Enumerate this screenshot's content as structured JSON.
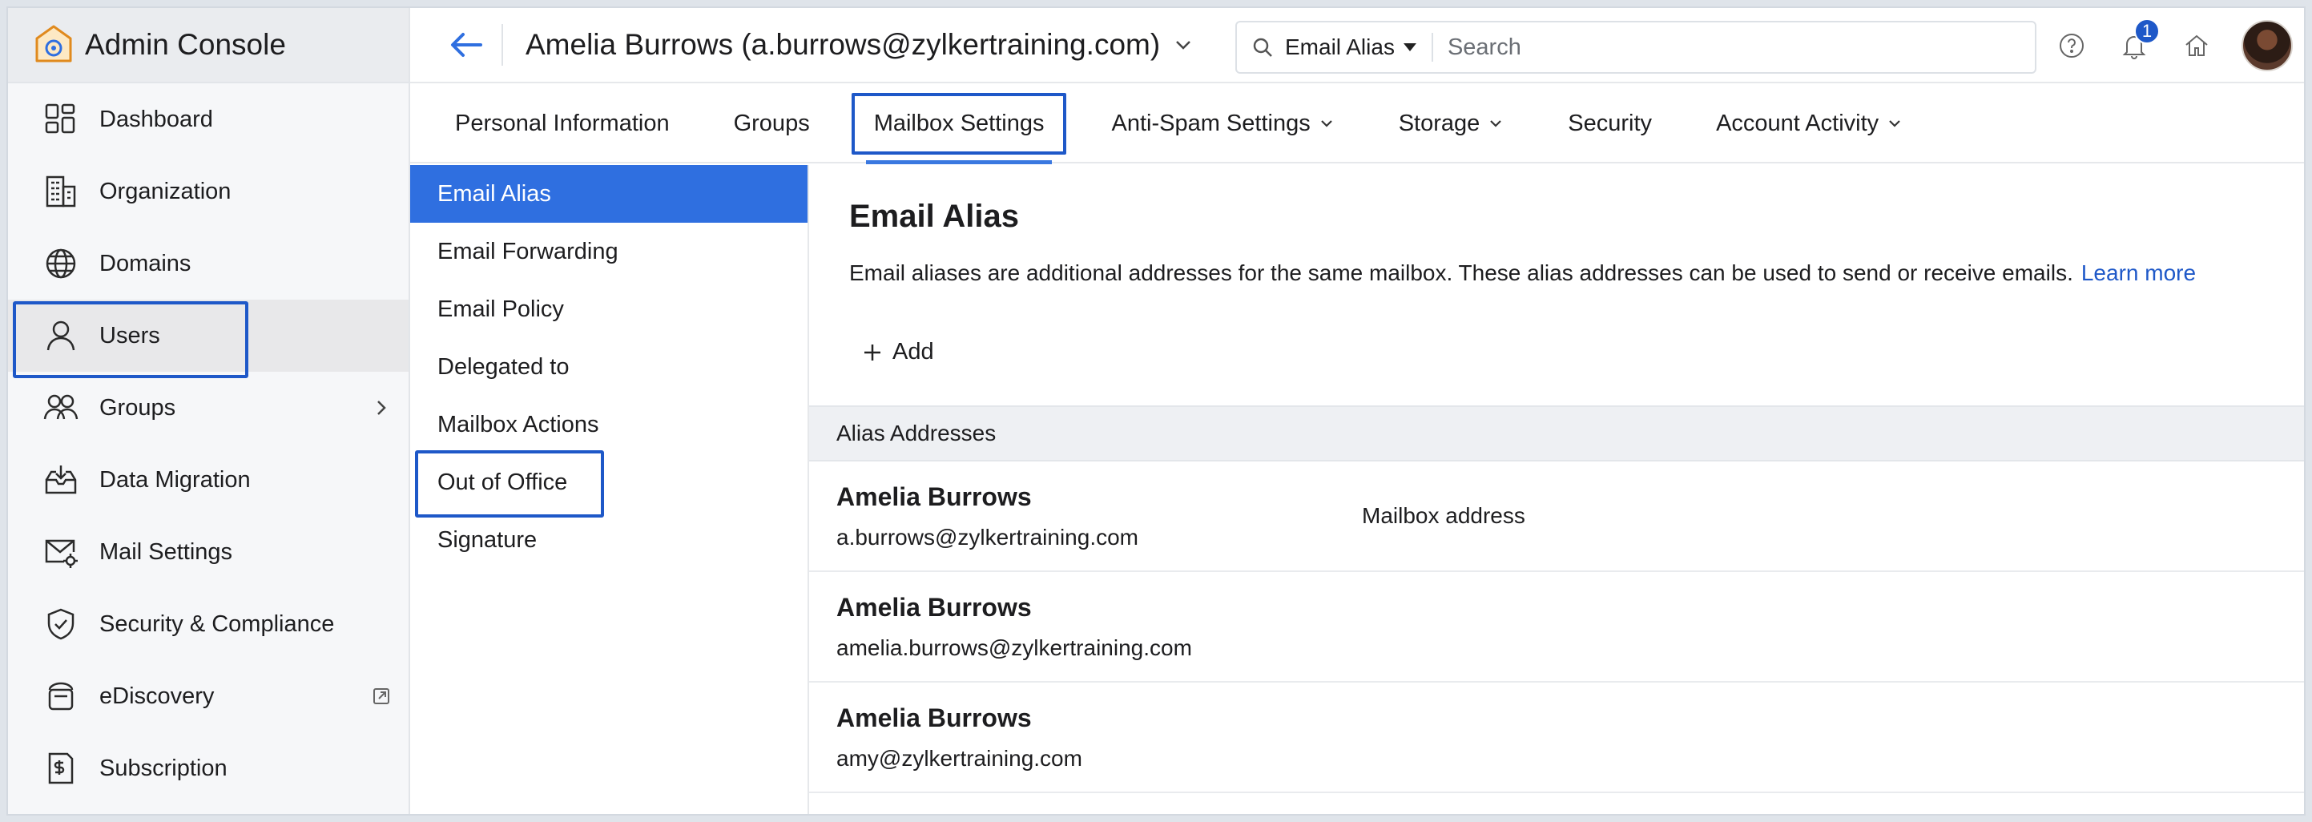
{
  "app": {
    "title": "Admin Console"
  },
  "sidebar": {
    "items": [
      {
        "label": "Dashboard"
      },
      {
        "label": "Organization"
      },
      {
        "label": "Domains"
      },
      {
        "label": "Users"
      },
      {
        "label": "Groups"
      },
      {
        "label": "Data Migration"
      },
      {
        "label": "Mail Settings"
      },
      {
        "label": "Security & Compliance"
      },
      {
        "label": "eDiscovery"
      },
      {
        "label": "Subscription"
      }
    ]
  },
  "header": {
    "user_title": "Amelia Burrows (a.burrows@zylkertraining.com)",
    "search_scope": "Email Alias",
    "search_placeholder": "Search",
    "notification_count": "1"
  },
  "tabs": [
    {
      "label": "Personal Information"
    },
    {
      "label": "Groups"
    },
    {
      "label": "Mailbox Settings"
    },
    {
      "label": "Anti-Spam Settings"
    },
    {
      "label": "Storage"
    },
    {
      "label": "Security"
    },
    {
      "label": "Account Activity"
    }
  ],
  "subnav": [
    {
      "label": "Email Alias"
    },
    {
      "label": "Email Forwarding"
    },
    {
      "label": "Email Policy"
    },
    {
      "label": "Delegated to"
    },
    {
      "label": "Mailbox Actions"
    },
    {
      "label": "Out of Office"
    },
    {
      "label": "Signature"
    }
  ],
  "content": {
    "title": "Email Alias",
    "description": "Email aliases are additional addresses for the same mailbox. These alias addresses can be used to send or receive emails.",
    "learn_more": "Learn more",
    "add_label": "Add",
    "table_header": "Alias Addresses",
    "rows": [
      {
        "name": "Amelia Burrows",
        "email": "a.burrows@zylkertraining.com",
        "note": "Mailbox address"
      },
      {
        "name": "Amelia Burrows",
        "email": "amelia.burrows@zylkertraining.com",
        "note": ""
      },
      {
        "name": "Amelia Burrows",
        "email": "amy@zylkertraining.com",
        "note": ""
      }
    ]
  },
  "colors": {
    "accent": "#1e58c8",
    "active_subnav": "#2f6fe0",
    "sidebar_bg": "#f6f7f9"
  }
}
